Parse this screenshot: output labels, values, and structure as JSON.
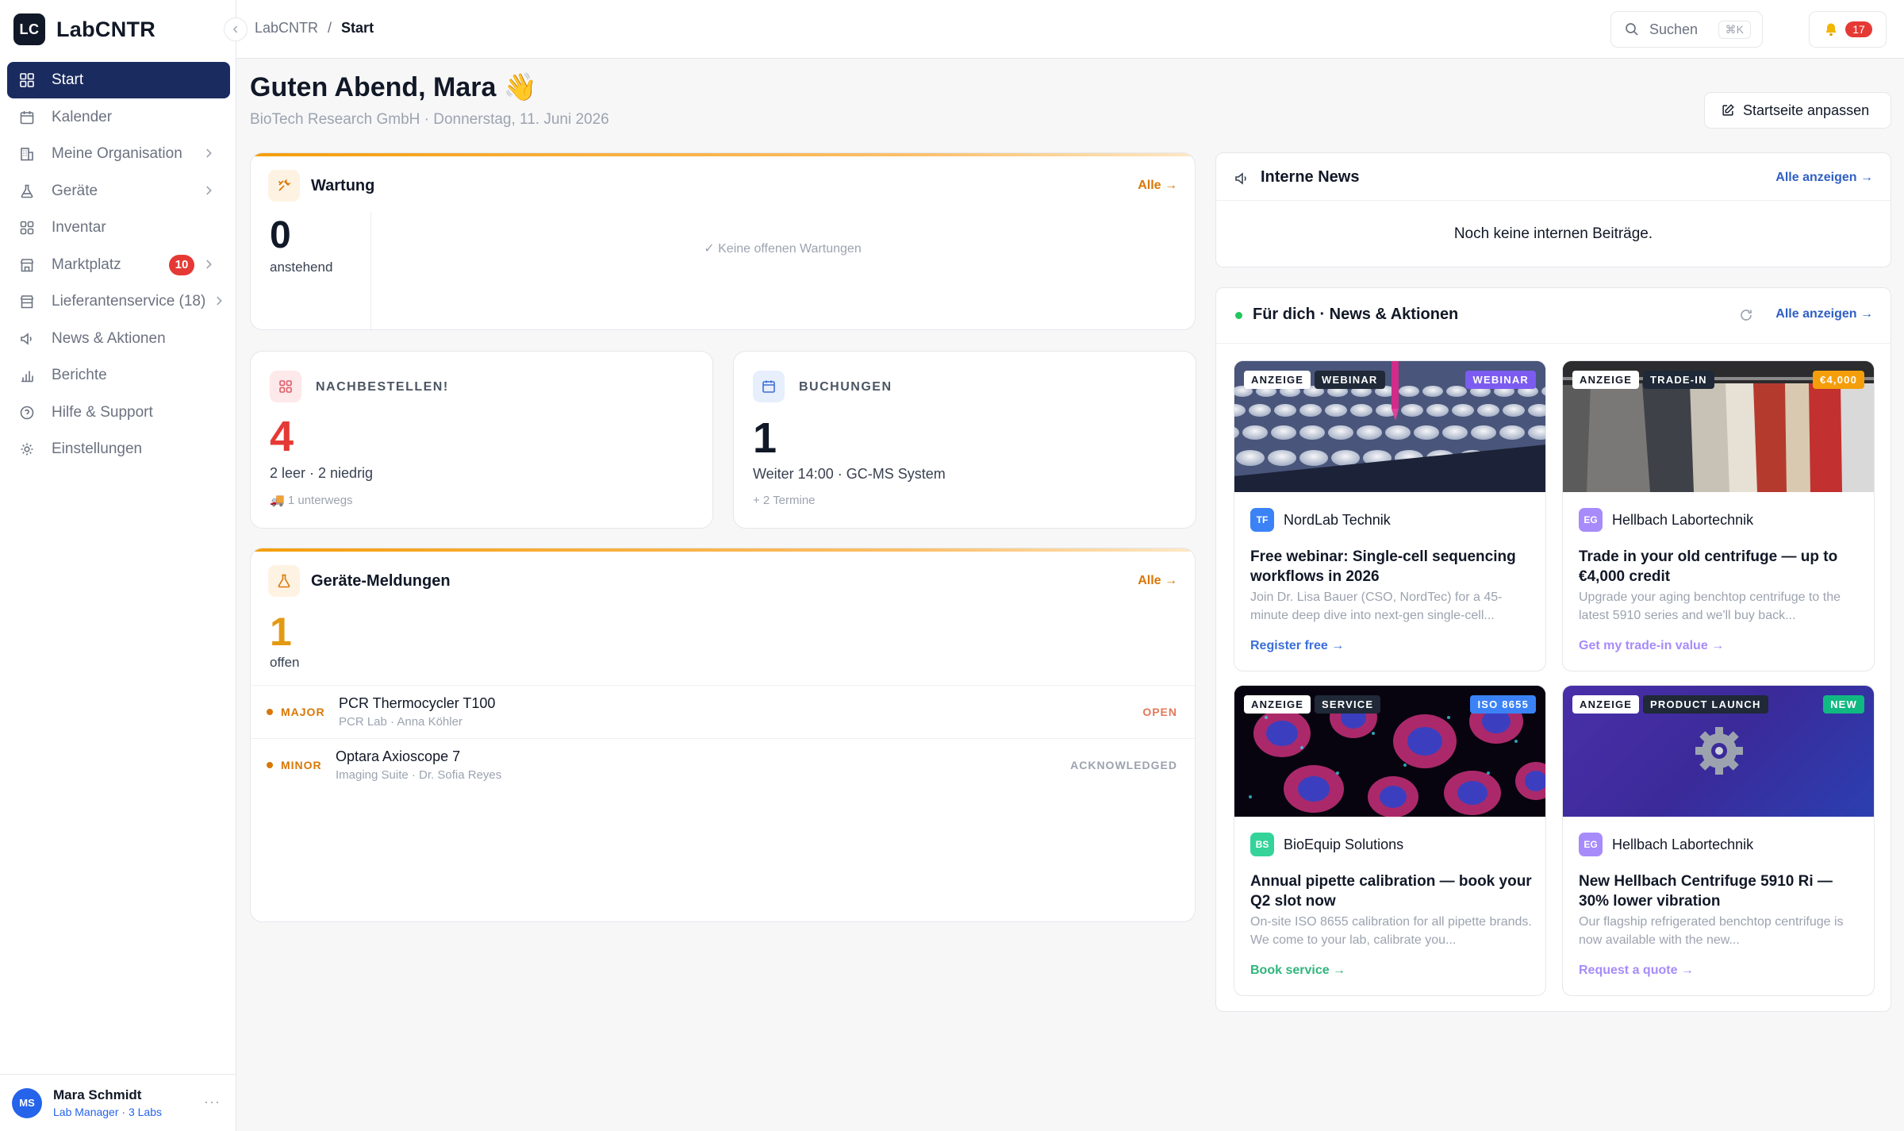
{
  "app": {
    "logo_text": "LC",
    "name": "LabCNTR"
  },
  "sidebar": {
    "items": [
      {
        "label": "Start",
        "icon": "grid-icon",
        "active": true
      },
      {
        "label": "Kalender",
        "icon": "calendar-icon"
      },
      {
        "label": "Meine Organisation",
        "icon": "building-icon",
        "chevron": true
      },
      {
        "label": "Geräte",
        "icon": "flask-icon",
        "chevron": true
      },
      {
        "label": "Inventar",
        "icon": "boxes-icon"
      },
      {
        "label": "Marktplatz",
        "icon": "store-icon",
        "badge": "10",
        "chevron": true
      },
      {
        "label": "Lieferantenservice (18)",
        "icon": "truck-store-icon",
        "chevron": true
      },
      {
        "label": "News & Aktionen",
        "icon": "megaphone-icon"
      },
      {
        "label": "Berichte",
        "icon": "bar-chart-icon"
      },
      {
        "label": "Hilfe & Support",
        "icon": "help-icon"
      },
      {
        "label": "Einstellungen",
        "icon": "gear-icon"
      }
    ],
    "user": {
      "initials": "MS",
      "name": "Mara Schmidt",
      "role": "Lab Manager · 3 Labs",
      "more": "···"
    }
  },
  "topbar": {
    "breadcrumb": {
      "root": "LabCNTR",
      "sep": "/",
      "current": "Start"
    },
    "search": {
      "label": "Suchen",
      "shortcut": "⌘K"
    },
    "notifications": {
      "count": "17"
    }
  },
  "header": {
    "greeting": "Guten Abend, Mara 👋",
    "subtitle": "BioTech Research GmbH · Donnerstag, 11. Juni 2026",
    "customize_label": "Startseite anpassen"
  },
  "wartung": {
    "title": "Wartung",
    "all": "Alle →",
    "count": "0",
    "count_label": "anstehend",
    "empty": "✓ Keine offenen Wartungen"
  },
  "reorder": {
    "title": "NACHBESTELLEN!",
    "count": "4",
    "detail": "2 leer · 2 niedrig",
    "note": "🚚 1 unterwegs"
  },
  "bookings": {
    "title": "BUCHUNGEN",
    "count": "1",
    "detail": "Weiter 14:00 · GC-MS System",
    "note": "+ 2 Termine"
  },
  "reports": {
    "title": "Geräte-Meldungen",
    "all": "Alle →",
    "count": "1",
    "count_label": "offen",
    "items": [
      {
        "severity": "MAJOR",
        "device": "PCR Thermocycler T100",
        "location": "PCR Lab · Anna Köhler",
        "status": "OPEN"
      },
      {
        "severity": "MINOR",
        "device": "Optara Axioscope 7",
        "location": "Imaging Suite · Dr. Sofia Reyes",
        "status": "ACKNOWLEDGED"
      }
    ]
  },
  "internal_news": {
    "title": "Interne News",
    "all": "Alle anzeigen →",
    "empty": "Noch keine internen Beiträge."
  },
  "for_you": {
    "title": "Für dich · News & Aktionen",
    "all": "Alle anzeigen →",
    "tiles": [
      {
        "ad": "ANZEIGE",
        "category": "WEBINAR",
        "right_tag": "WEBINAR",
        "right_color": "#7c5cf0",
        "vendor_logo": "TF",
        "vendor_color": "#3b82f6",
        "vendor": "NordLab Technik",
        "title": "Free webinar: Single-cell sequencing workflows in 2026",
        "body": "Join Dr. Lisa Bauer (CSO, NordTec) for a 45-minute deep dive into next-gen single-cell...",
        "cta": "Register free →",
        "cta_color": "#3b6fd8"
      },
      {
        "ad": "ANZEIGE",
        "category": "TRADE-IN",
        "right_tag": "€4,000",
        "right_color": "#f59e0b",
        "vendor_logo": "EG",
        "vendor_color": "#a78bfa",
        "vendor": "Hellbach Labortechnik",
        "title": "Trade in your old centrifuge — up to €4,000 credit",
        "body": "Upgrade your aging benchtop centrifuge to the latest 5910 series and we'll buy back...",
        "cta": "Get my trade-in value →",
        "cta_color": "#a78bfa"
      },
      {
        "ad": "ANZEIGE",
        "category": "SERVICE",
        "right_tag": "ISO 8655",
        "right_color": "#3b82f6",
        "vendor_logo": "BS",
        "vendor_color": "#34d399",
        "vendor": "BioEquip Solutions",
        "title": "Annual pipette calibration — book your Q2 slot now",
        "body": "On-site ISO 8655 calibration for all pipette brands. We come to your lab, calibrate you...",
        "cta": "Book service →",
        "cta_color": "#2fb67c"
      },
      {
        "ad": "ANZEIGE",
        "category": "PRODUCT LAUNCH",
        "right_tag": "NEW",
        "right_color": "#10b981",
        "vendor_logo": "EG",
        "vendor_color": "#a78bfa",
        "vendor": "Hellbach Labortechnik",
        "title": "New Hellbach Centrifuge 5910 Ri — 30% lower vibration",
        "body": "Our flagship refrigerated benchtop centrifuge is now available with the new...",
        "cta": "Request a quote →",
        "cta_color": "#a78bfa"
      }
    ]
  }
}
